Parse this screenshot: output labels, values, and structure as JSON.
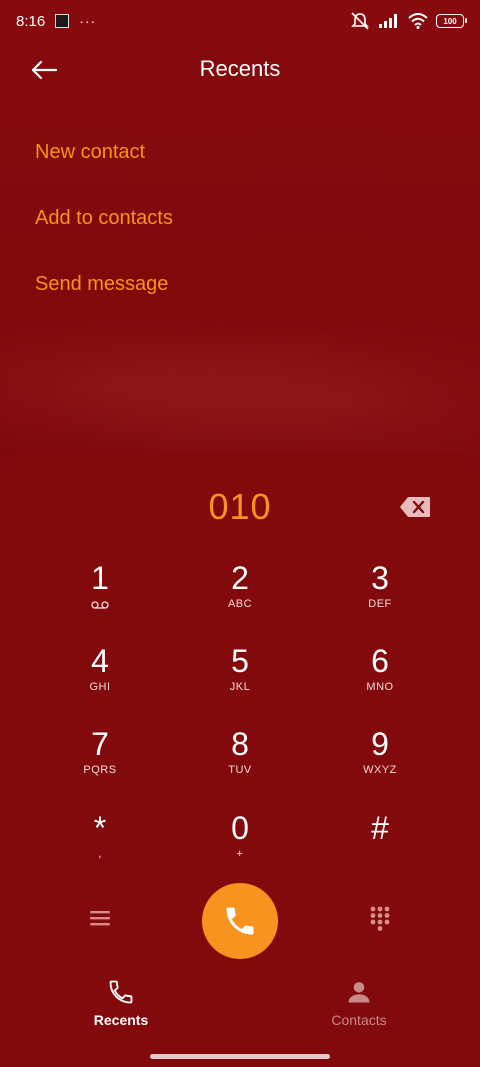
{
  "status_bar": {
    "time": "8:16",
    "overflow_dots": "···",
    "battery": "100"
  },
  "header": {
    "title": "Recents"
  },
  "actions": {
    "new_contact": "New contact",
    "add_to_contacts": "Add to contacts",
    "send_message": "Send message"
  },
  "dialer": {
    "number": "010",
    "keys": [
      {
        "digit": "1",
        "letters": ""
      },
      {
        "digit": "2",
        "letters": "ABC"
      },
      {
        "digit": "3",
        "letters": "DEF"
      },
      {
        "digit": "4",
        "letters": "GHI"
      },
      {
        "digit": "5",
        "letters": "JKL"
      },
      {
        "digit": "6",
        "letters": "MNO"
      },
      {
        "digit": "7",
        "letters": "PQRS"
      },
      {
        "digit": "8",
        "letters": "TUV"
      },
      {
        "digit": "9",
        "letters": "WXYZ"
      },
      {
        "digit": "*",
        "letters": ","
      },
      {
        "digit": "0",
        "letters": "+"
      },
      {
        "digit": "#",
        "letters": ""
      }
    ]
  },
  "bottom_nav": {
    "recents_label": "Recents",
    "contacts_label": "Contacts"
  },
  "colors": {
    "background": "#820a0d",
    "accent": "#f7931e",
    "inactive_tab": "#c98989"
  },
  "icons": {
    "back": "arrow-left-icon",
    "backspace": "backspace-icon",
    "voicemail": "voicemail-icon",
    "menu": "menu-icon",
    "call": "phone-icon",
    "dialpad": "dialpad-icon",
    "recents_tab": "phone-icon",
    "contacts_tab": "person-icon"
  }
}
